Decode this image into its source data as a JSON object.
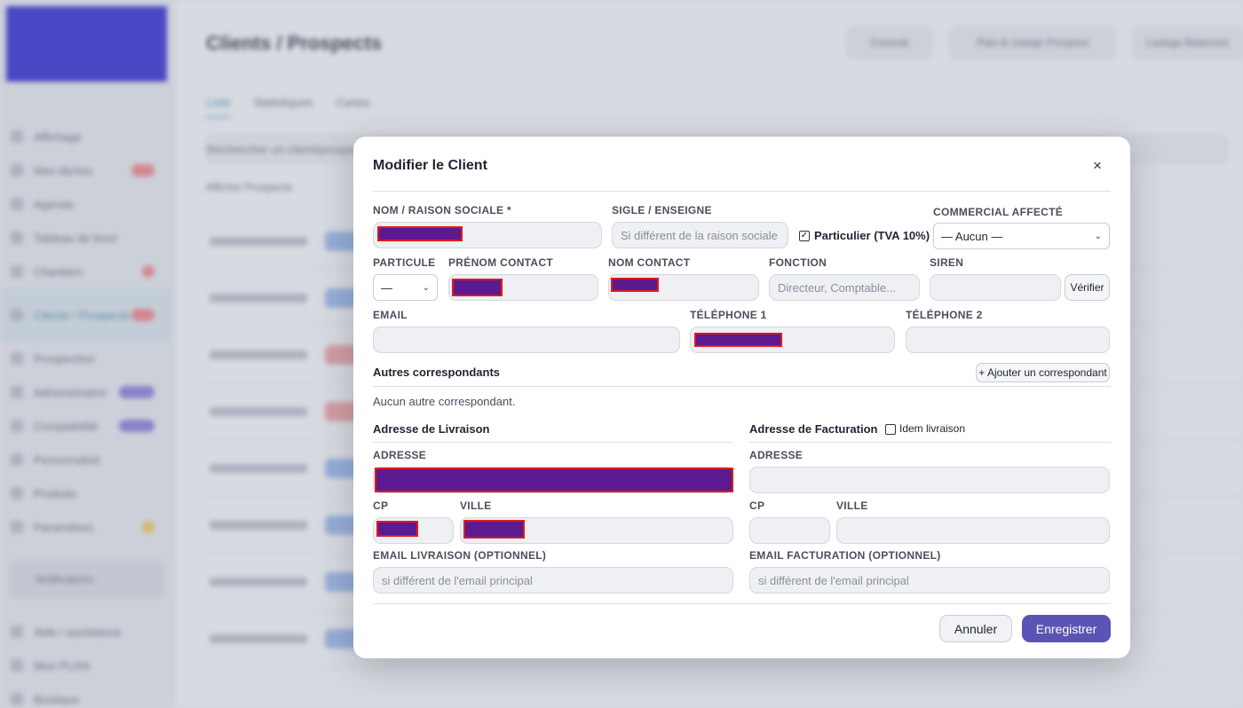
{
  "background": {
    "app_title": "Clients / Prospects",
    "buttons": [
      "Console",
      "Plan & charge Prospect",
      "Ladage Balances"
    ],
    "tabs": [
      "Liste",
      "Statistiques",
      "Cartes"
    ],
    "search_placeholder": "Rechercher un client/prospect...",
    "subtitle": "Afficher Prospects",
    "nav": [
      "Affichage",
      "Mes tâches",
      "Agenda",
      "Tableau de bord",
      "Chantiers",
      "Clients / Prospects",
      "Prospection",
      "Administration",
      "Comptabilité",
      "Personnalisé",
      "Produits",
      "Paramètres"
    ],
    "notifications_label": "Notifications",
    "nav_bottom": [
      "Aide / assistance",
      "Mon PLAN",
      "Boutique"
    ]
  },
  "modal": {
    "title": "Modifier le Client",
    "close_symbol": "×",
    "fields": {
      "nom_label": "NOM / RAISON SOCIALE *",
      "sigle_label": "SIGLE / ENSEIGNE",
      "sigle_placeholder": "Si différent de la raison sociale",
      "particulier_label": "Particulier (TVA 10%)",
      "particulier_checked": true,
      "commercial_label": "COMMERCIAL AFFECTÉ",
      "commercial_value": "— Aucun —",
      "particule_label": "PARTICULE",
      "particule_value": "—",
      "prenom_label": "PRÉNOM CONTACT",
      "nomcontact_label": "NOM CONTACT",
      "fonction_label": "FONCTION",
      "fonction_placeholder": "Directeur, Comptable...",
      "siren_label": "SIREN",
      "verifier_label": "Vérifier",
      "email_label": "EMAIL",
      "tel1_label": "TÉLÉPHONE 1",
      "tel2_label": "TÉLÉPHONE 2"
    },
    "correspondants": {
      "title": "Autres correspondants",
      "add_label": "+ Ajouter un correspondant",
      "empty_text": "Aucun autre correspondant."
    },
    "livraison": {
      "title": "Adresse de Livraison",
      "adresse_label": "ADRESSE",
      "cp_label": "CP",
      "ville_label": "VILLE",
      "email_label": "EMAIL LIVRAISON (OPTIONNEL)",
      "email_placeholder": "si différent de l'email principal"
    },
    "facturation": {
      "title": "Adresse de Facturation",
      "idem_label": "Idem livraison",
      "idem_checked": false,
      "adresse_label": "ADRESSE",
      "cp_label": "CP",
      "ville_label": "VILLE",
      "email_label": "EMAIL FACTURATION (OPTIONNEL)",
      "email_placeholder": "si différent de l'email principal"
    },
    "cancel_label": "Annuler",
    "save_label": "Enregistrer"
  },
  "colors": {
    "primary": "#5b54b5",
    "redaction_fill": "#5b1a8f",
    "redaction_border": "#e01a1a"
  }
}
